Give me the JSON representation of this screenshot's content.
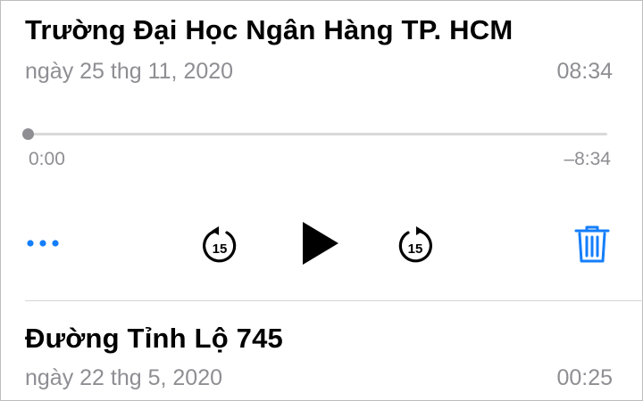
{
  "colors": {
    "accent": "#147efb",
    "secondary_text": "#8e8e93",
    "track": "#d9d9d9"
  },
  "recordings": [
    {
      "title": "Trường Đại Học Ngân Hàng TP. HCM",
      "date": "ngày 25 thg 11, 2020",
      "duration": "08:34",
      "expanded": true,
      "player": {
        "progress": 0,
        "elapsed": "0:00",
        "remaining": "–8:34",
        "controls": {
          "more_icon": "ellipsis-icon",
          "rewind_icon": "skip-back-15-icon",
          "rewind_seconds": "15",
          "play_icon": "play-icon",
          "forward_icon": "skip-forward-15-icon",
          "forward_seconds": "15",
          "delete_icon": "trash-icon"
        }
      }
    },
    {
      "title": "Đường Tỉnh Lộ 745",
      "date": "ngày 22 thg 5, 2020",
      "duration": "00:25",
      "expanded": false
    }
  ]
}
